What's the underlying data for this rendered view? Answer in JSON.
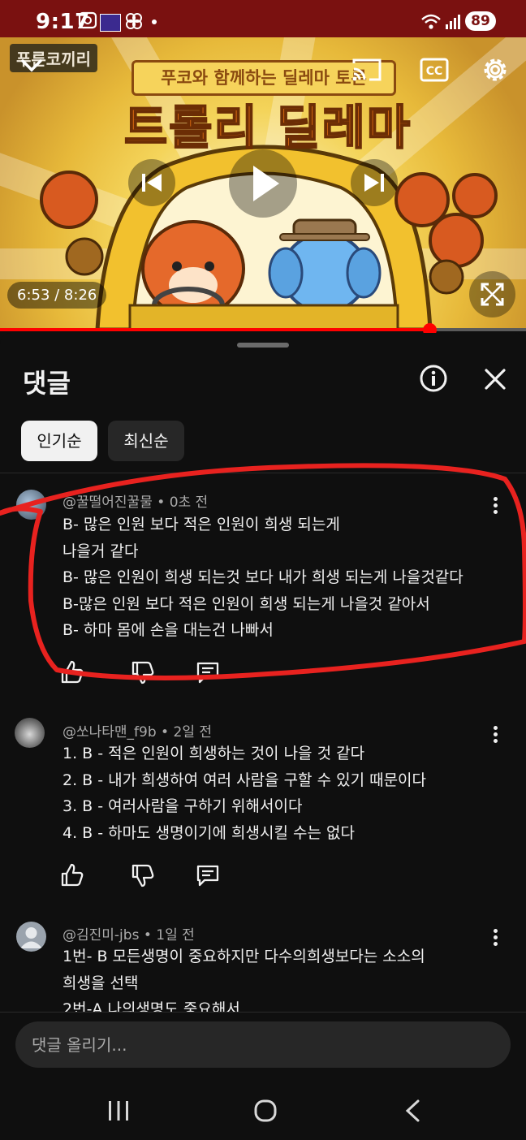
{
  "status_bar": {
    "time": "9:17",
    "battery": "89"
  },
  "video": {
    "brand": "푸른코끼리",
    "subtitle": "푸코와 함께하는 딜레마 토론",
    "title": "트롤리 딜레마",
    "time_display": "6:53 / 8:26",
    "progress_fraction": 0.816
  },
  "comments_panel": {
    "title": "댓글",
    "sort_chips": [
      {
        "label": "인기순",
        "selected": true
      },
      {
        "label": "최신순",
        "selected": false
      }
    ],
    "comments": [
      {
        "author": "@꿀떨어진꿀물",
        "age": "0초 전",
        "lines": [
          "B- 많은 인원 보다 적은 인원이 희생 되는게",
          "나을거 같다",
          "B- 많은 인원이 희생 되는것 보다 내가 희생 되는게 나을것같다",
          "B-많은 인원 보다 적은 인원이 희생 되는게 나을것 같아서",
          "B-  하마 몸에 손을 대는건 나빠서"
        ]
      },
      {
        "author": "@쏘나타맨_f9b",
        "age": "2일 전",
        "lines": [
          "1. B - 적은 인원이 희생하는 것이 나을 것 같다",
          "2. B - 내가 희생하여 여러 사람을 구할 수 있기 때문이다",
          "3. B - 여러사람을 구하기 위해서이다",
          "4. B - 하마도 생명이기에 희생시킬 수는 없다"
        ]
      },
      {
        "author": "@김진미-jbs",
        "age": "1일 전",
        "lines": [
          "1번- B 모든생명이 중요하지만 다수의희생보다는 소소의",
          "희생을 선택",
          "2번-A 나의생명도 중요해서"
        ]
      }
    ],
    "input_placeholder": "댓글 올리기..."
  },
  "colors": {
    "status_bar": "#7a1110",
    "background": "#0f0f0f",
    "progress": "#ff0000",
    "highlight_stroke": "#e8221f"
  }
}
